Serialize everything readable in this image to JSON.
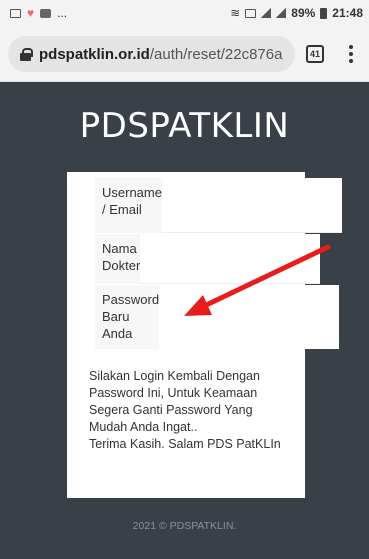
{
  "status_bar": {
    "left_extra": "...",
    "battery": "89%",
    "time": "21:48"
  },
  "browser": {
    "url_host": "pdspatklin.or.id",
    "url_path": "/auth/reset/22c876a",
    "tab_count": "41"
  },
  "page": {
    "brand": "PDSPATKLIN",
    "fields": [
      {
        "label": "Username / Email"
      },
      {
        "label": "Nama Dokter"
      },
      {
        "label": "Password Baru Anda"
      }
    ],
    "message_lines": [
      "Silakan Login Kembali Dengan",
      "Password Ini, Untuk Keamaan",
      "Segera Ganti Password Yang",
      "Mudah Anda Ingat..",
      "Terima Kasih. Salam PDS PatKLIn"
    ],
    "footer": "2021 © PDSPATKLIN."
  },
  "colors": {
    "background": "#3a4048",
    "annotation_arrow": "#e81c1c"
  }
}
